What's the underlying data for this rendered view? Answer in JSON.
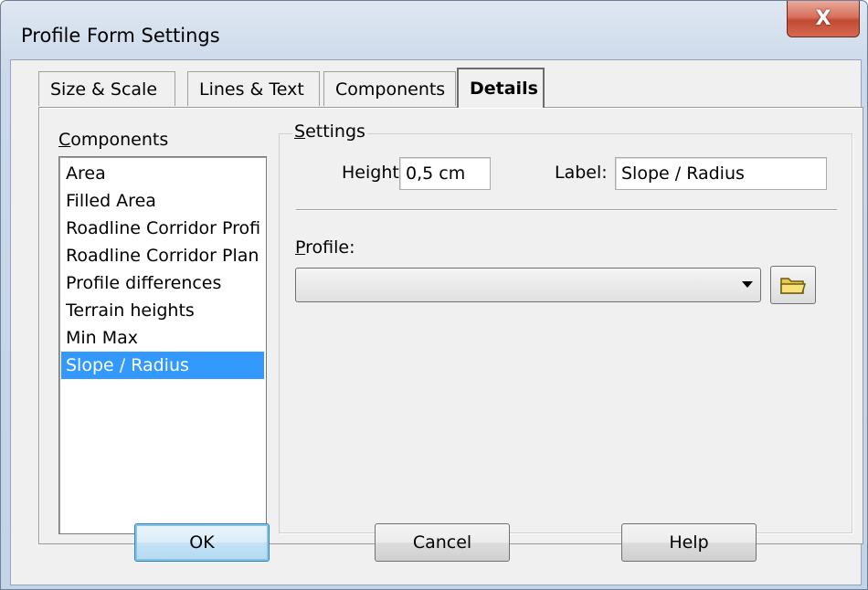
{
  "window": {
    "title": "Profile Form Settings",
    "close_glyph": "X"
  },
  "tabs": [
    {
      "label": "Size & Scale"
    },
    {
      "label": "Lines & Text"
    },
    {
      "label": "Components"
    },
    {
      "label": "Details",
      "active": true
    }
  ],
  "components": {
    "label_first": "C",
    "label_rest": "omponents",
    "items": [
      "Area",
      "Filled Area",
      "Roadline Corridor Profi",
      "Roadline Corridor Plan",
      "Profile differences",
      "Terrain heights",
      "Min Max",
      "Slope / Radius"
    ],
    "selected_index": 7
  },
  "settings": {
    "legend_first": "S",
    "legend_rest": "ettings",
    "height_label": "Height:",
    "height_value": "0,5 cm",
    "label_label": "Label:",
    "label_value": "Slope / Radius",
    "profile_label_first": "P",
    "profile_label_rest": "rofile:",
    "profile_value": ""
  },
  "icons": {
    "close": "close-icon",
    "dropdown": "chevron-down-icon",
    "browse": "folder-icon"
  },
  "buttons": {
    "ok": "OK",
    "cancel": "Cancel",
    "help": "Help"
  },
  "colors": {
    "selection": "#3399ff",
    "close_button": "#c24a33",
    "title_bar": "#cad8ea"
  }
}
